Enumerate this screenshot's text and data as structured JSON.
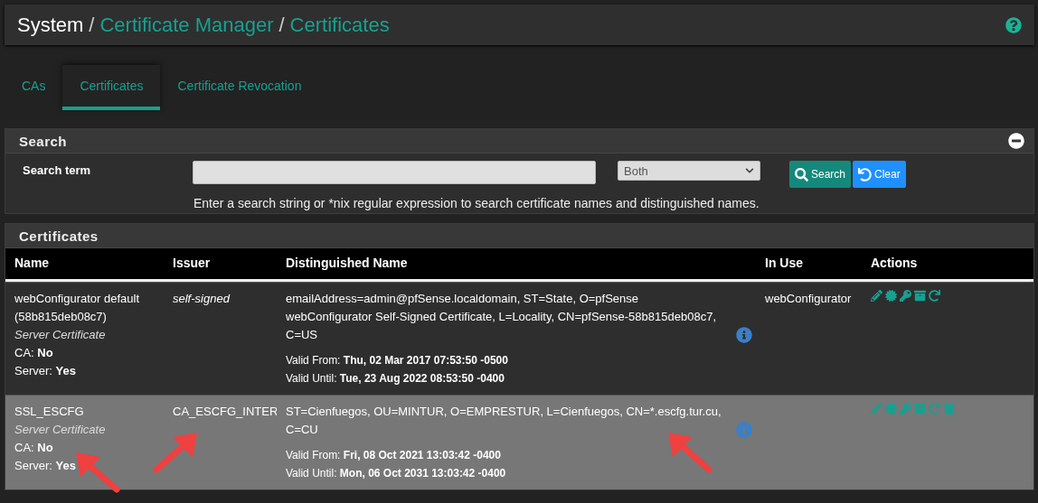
{
  "breadcrumb": {
    "root": "System",
    "separator": "/",
    "links": [
      "Certificate Manager",
      "Certificates"
    ]
  },
  "tabs": [
    {
      "label": "CAs",
      "selected": false
    },
    {
      "label": "Certificates",
      "selected": true
    },
    {
      "label": "Certificate Revocation",
      "selected": false
    }
  ],
  "search": {
    "title": "Search",
    "label": "Search term",
    "scope": "Both",
    "buttons": [
      {
        "kind": "search",
        "label": "Search"
      },
      {
        "kind": "clear",
        "label": "Clear"
      }
    ],
    "help": "Enter a search string or *nix regular expression to search certificate names and distinguished names."
  },
  "certificates": {
    "title": "Certificates",
    "columns": [
      "Name",
      "Issuer",
      "Distinguished Name",
      "In Use",
      "Actions"
    ],
    "rows": [
      {
        "name": "webConfigurator default (58b815deb08c7)",
        "type": "Server Certificate",
        "ca_label": "CA:",
        "ca": "No",
        "server_label": "Server:",
        "server": "Yes",
        "issuer": "self-signed",
        "issuer_self": true,
        "dn": "emailAddress=admin@pfSense.localdomain, ST=State, O=pfSense webConfigurator Self-Signed Certificate, L=Locality, CN=pfSense-58b815deb08c7, C=US",
        "valid_from_label": "Valid From:",
        "valid_from": "Thu, 02 Mar 2017 07:53:50 -0500",
        "valid_until_label": "Valid Until:",
        "valid_until": "Tue, 23 Aug 2022 08:53:50 -0400",
        "in_use": "webConfigurator",
        "deletable": false,
        "highlighted": false,
        "annotated": false
      },
      {
        "name": "SSL_ESCFG",
        "type": "Server Certificate",
        "ca_label": "CA:",
        "ca": "No",
        "server_label": "Server:",
        "server": "Yes",
        "issuer": "CA_ESCFG_INTER",
        "issuer_self": false,
        "dn": "ST=Cienfuegos, OU=MINTUR, O=EMPRESTUR, L=Cienfuegos, CN=*.escfg.tur.cu, C=CU",
        "valid_from_label": "Valid From:",
        "valid_from": "Fri, 08 Oct 2021 13:03:42 -0400",
        "valid_until_label": "Valid Until:",
        "valid_until": "Mon, 06 Oct 2031 13:03:42 -0400",
        "deletable": true,
        "highlighted": true,
        "annotated": true
      }
    ]
  }
}
